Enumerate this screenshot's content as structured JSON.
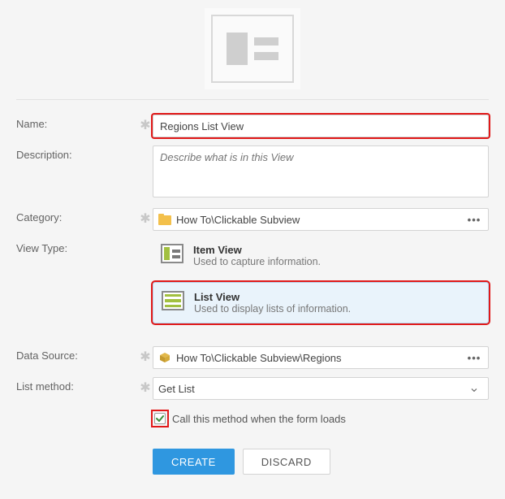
{
  "labels": {
    "name": "Name:",
    "description": "Description:",
    "category": "Category:",
    "view_type": "View Type:",
    "data_source": "Data Source:",
    "list_method": "List method:"
  },
  "fields": {
    "name_value": "Regions List View",
    "description_placeholder": "Describe what is in this View",
    "category_value": "How To\\Clickable Subview",
    "data_source_value": "How To\\Clickable Subview\\Regions",
    "list_method_value": "Get List",
    "call_on_load_label": "Call this method when the form loads",
    "call_on_load_checked": true
  },
  "view_types": {
    "item": {
      "title": "Item View",
      "desc": "Used to capture information."
    },
    "list": {
      "title": "List View",
      "desc": "Used to display lists of information."
    }
  },
  "buttons": {
    "create": "CREATE",
    "discard": "DISCARD"
  }
}
